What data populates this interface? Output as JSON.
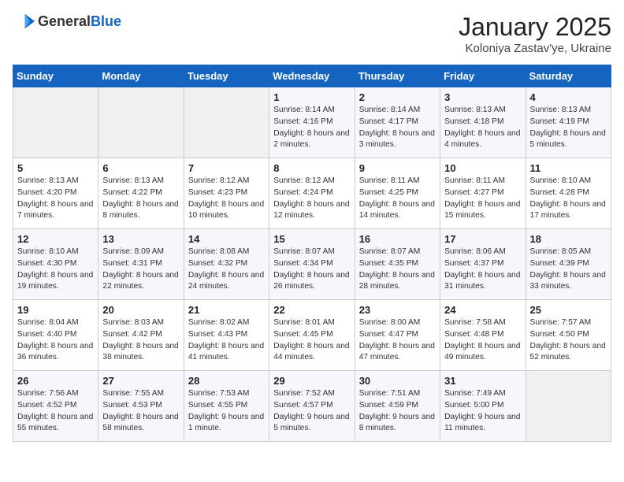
{
  "header": {
    "logo_general": "General",
    "logo_blue": "Blue",
    "month": "January 2025",
    "location": "Koloniya Zastav'ye, Ukraine"
  },
  "weekdays": [
    "Sunday",
    "Monday",
    "Tuesday",
    "Wednesday",
    "Thursday",
    "Friday",
    "Saturday"
  ],
  "weeks": [
    [
      {
        "day": "",
        "empty": true
      },
      {
        "day": "",
        "empty": true
      },
      {
        "day": "",
        "empty": true
      },
      {
        "day": "1",
        "sunrise": "8:14 AM",
        "sunset": "4:16 PM",
        "daylight": "8 hours and 2 minutes."
      },
      {
        "day": "2",
        "sunrise": "8:14 AM",
        "sunset": "4:17 PM",
        "daylight": "8 hours and 3 minutes."
      },
      {
        "day": "3",
        "sunrise": "8:13 AM",
        "sunset": "4:18 PM",
        "daylight": "8 hours and 4 minutes."
      },
      {
        "day": "4",
        "sunrise": "8:13 AM",
        "sunset": "4:19 PM",
        "daylight": "8 hours and 5 minutes."
      }
    ],
    [
      {
        "day": "5",
        "sunrise": "8:13 AM",
        "sunset": "4:20 PM",
        "daylight": "8 hours and 7 minutes."
      },
      {
        "day": "6",
        "sunrise": "8:13 AM",
        "sunset": "4:22 PM",
        "daylight": "8 hours and 8 minutes."
      },
      {
        "day": "7",
        "sunrise": "8:12 AM",
        "sunset": "4:23 PM",
        "daylight": "8 hours and 10 minutes."
      },
      {
        "day": "8",
        "sunrise": "8:12 AM",
        "sunset": "4:24 PM",
        "daylight": "8 hours and 12 minutes."
      },
      {
        "day": "9",
        "sunrise": "8:11 AM",
        "sunset": "4:25 PM",
        "daylight": "8 hours and 14 minutes."
      },
      {
        "day": "10",
        "sunrise": "8:11 AM",
        "sunset": "4:27 PM",
        "daylight": "8 hours and 15 minutes."
      },
      {
        "day": "11",
        "sunrise": "8:10 AM",
        "sunset": "4:28 PM",
        "daylight": "8 hours and 17 minutes."
      }
    ],
    [
      {
        "day": "12",
        "sunrise": "8:10 AM",
        "sunset": "4:30 PM",
        "daylight": "8 hours and 19 minutes."
      },
      {
        "day": "13",
        "sunrise": "8:09 AM",
        "sunset": "4:31 PM",
        "daylight": "8 hours and 22 minutes."
      },
      {
        "day": "14",
        "sunrise": "8:08 AM",
        "sunset": "4:32 PM",
        "daylight": "8 hours and 24 minutes."
      },
      {
        "day": "15",
        "sunrise": "8:07 AM",
        "sunset": "4:34 PM",
        "daylight": "8 hours and 26 minutes."
      },
      {
        "day": "16",
        "sunrise": "8:07 AM",
        "sunset": "4:35 PM",
        "daylight": "8 hours and 28 minutes."
      },
      {
        "day": "17",
        "sunrise": "8:06 AM",
        "sunset": "4:37 PM",
        "daylight": "8 hours and 31 minutes."
      },
      {
        "day": "18",
        "sunrise": "8:05 AM",
        "sunset": "4:39 PM",
        "daylight": "8 hours and 33 minutes."
      }
    ],
    [
      {
        "day": "19",
        "sunrise": "8:04 AM",
        "sunset": "4:40 PM",
        "daylight": "8 hours and 36 minutes."
      },
      {
        "day": "20",
        "sunrise": "8:03 AM",
        "sunset": "4:42 PM",
        "daylight": "8 hours and 38 minutes."
      },
      {
        "day": "21",
        "sunrise": "8:02 AM",
        "sunset": "4:43 PM",
        "daylight": "8 hours and 41 minutes."
      },
      {
        "day": "22",
        "sunrise": "8:01 AM",
        "sunset": "4:45 PM",
        "daylight": "8 hours and 44 minutes."
      },
      {
        "day": "23",
        "sunrise": "8:00 AM",
        "sunset": "4:47 PM",
        "daylight": "8 hours and 47 minutes."
      },
      {
        "day": "24",
        "sunrise": "7:58 AM",
        "sunset": "4:48 PM",
        "daylight": "8 hours and 49 minutes."
      },
      {
        "day": "25",
        "sunrise": "7:57 AM",
        "sunset": "4:50 PM",
        "daylight": "8 hours and 52 minutes."
      }
    ],
    [
      {
        "day": "26",
        "sunrise": "7:56 AM",
        "sunset": "4:52 PM",
        "daylight": "8 hours and 55 minutes."
      },
      {
        "day": "27",
        "sunrise": "7:55 AM",
        "sunset": "4:53 PM",
        "daylight": "8 hours and 58 minutes."
      },
      {
        "day": "28",
        "sunrise": "7:53 AM",
        "sunset": "4:55 PM",
        "daylight": "9 hours and 1 minute."
      },
      {
        "day": "29",
        "sunrise": "7:52 AM",
        "sunset": "4:57 PM",
        "daylight": "9 hours and 5 minutes."
      },
      {
        "day": "30",
        "sunrise": "7:51 AM",
        "sunset": "4:59 PM",
        "daylight": "9 hours and 8 minutes."
      },
      {
        "day": "31",
        "sunrise": "7:49 AM",
        "sunset": "5:00 PM",
        "daylight": "9 hours and 11 minutes."
      },
      {
        "day": "",
        "empty": true
      }
    ]
  ],
  "labels": {
    "sunrise": "Sunrise:",
    "sunset": "Sunset:",
    "daylight": "Daylight:"
  }
}
